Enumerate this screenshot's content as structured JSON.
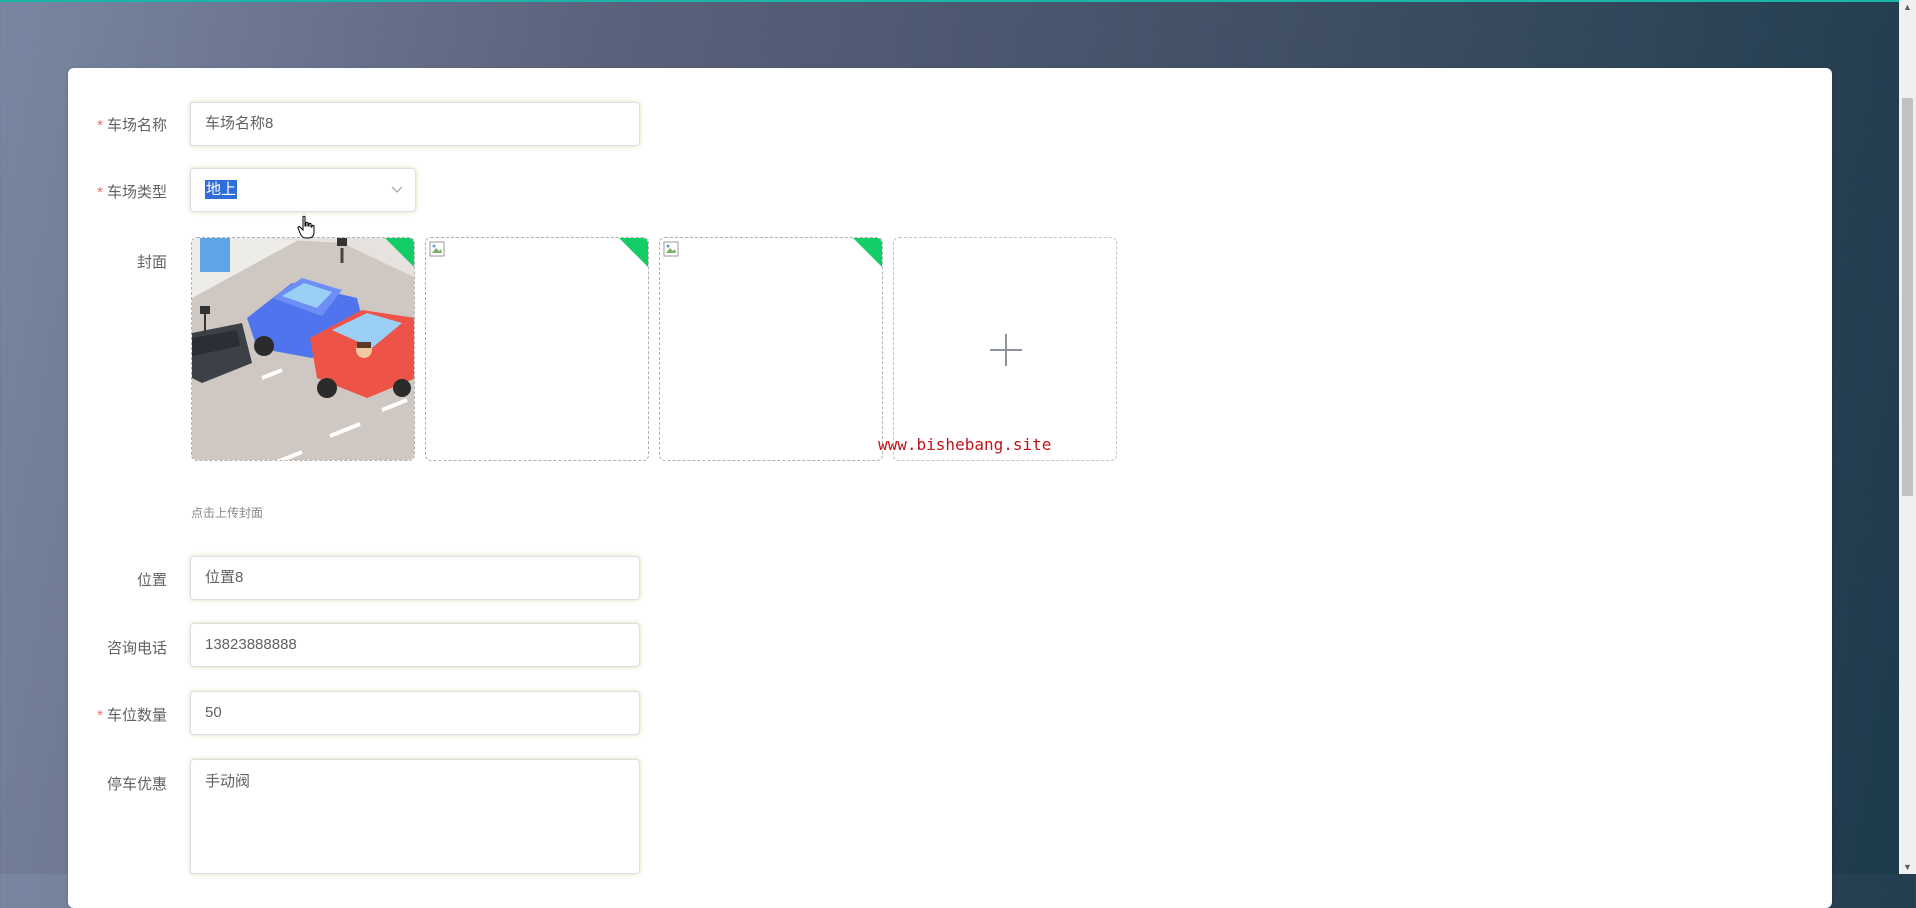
{
  "form": {
    "name": {
      "label": "车场名称",
      "required": true,
      "value": "车场名称8"
    },
    "type": {
      "label": "车场类型",
      "required": true,
      "value": "地上"
    },
    "cover": {
      "label": "封面",
      "hint": "点击上传封面",
      "images": [
        {
          "kind": "parking-illustration",
          "uploaded": true
        },
        {
          "kind": "broken-image",
          "uploaded": true
        },
        {
          "kind": "broken-image",
          "uploaded": true
        }
      ],
      "watermark": "www.bishebang.site"
    },
    "location": {
      "label": "位置",
      "required": false,
      "value": "位置8"
    },
    "phone": {
      "label": "咨询电话",
      "required": false,
      "value": "13823888888"
    },
    "spaces": {
      "label": "车位数量",
      "required": true,
      "value": "50"
    },
    "discount": {
      "label": "停车优惠",
      "required": false,
      "value": "手动阀"
    }
  },
  "required_marker": "*",
  "colors": {
    "success_badge": "#13ce66",
    "required": "#f56c6c",
    "selection": "#2f6ed8"
  }
}
